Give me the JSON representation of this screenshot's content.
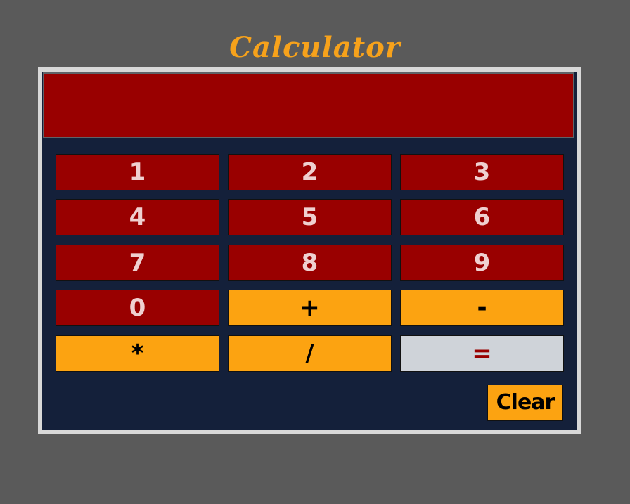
{
  "app": {
    "title": "Calculator"
  },
  "display": {
    "value": ""
  },
  "keys": {
    "one": "1",
    "two": "2",
    "three": "3",
    "four": "4",
    "five": "5",
    "six": "6",
    "seven": "7",
    "eight": "8",
    "nine": "9",
    "zero": "0",
    "plus": "+",
    "minus": "-",
    "multiply": "*",
    "divide": "/",
    "equals": "=",
    "clear": "Clear"
  },
  "colors": {
    "page_background": "#5a5a5a",
    "title": "#f7a21b",
    "frame_border": "#d8d8d8",
    "panel_background": "#14203a",
    "number_key": "#990000",
    "number_text": "#efd0d0",
    "operator_key": "#fca311",
    "equals_key": "#cfd3d9",
    "equals_text": "#990000"
  }
}
